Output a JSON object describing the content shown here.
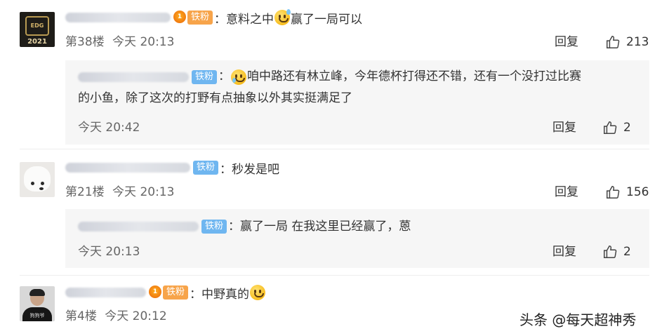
{
  "comments": [
    {
      "badge": "铁粉",
      "text": "：意料之中",
      "text_after_emoji": "赢了一局可以",
      "emoji": "sweat-smile",
      "avatar_year": "2021",
      "avatar_logo": "EDG",
      "floor": "第38楼",
      "time": "今天 20:13",
      "reply_label": "回复",
      "likes": "213",
      "reply": {
        "badge": "铁粉",
        "colon": "：",
        "emoji": "crying-sweat",
        "text_line1": "咱中路还有林立峰，今年德杯打得还不错，还有一个没打过比赛",
        "text_line2": "的小鱼，除了这次的打野有点抽象以外其实挺满足了",
        "time": "今天 20:42",
        "reply_label": "回复",
        "likes": "2"
      }
    },
    {
      "badge": "铁粉",
      "text": "：秒发是吧",
      "floor": "第21楼",
      "time": "今天 20:13",
      "reply_label": "回复",
      "likes": "156",
      "reply": {
        "badge": "铁粉",
        "text": "：赢了一局 在我这里已经赢了，蒽",
        "time": "今天 20:13",
        "reply_label": "回复",
        "likes": "2"
      }
    },
    {
      "badge": "铁粉",
      "text": "：中野真的",
      "emoji": "grin-sweat",
      "avatar_tag": "狗狗爷",
      "floor": "第4楼",
      "time": "今天 20:12"
    }
  ],
  "watermark": "头条 @每天超神秀",
  "colors": {
    "badge_blue": "#6fb6f0",
    "badge_orange": "#f7a44a",
    "reply_bg": "#f6f6f6",
    "meta_gray": "#666666"
  },
  "icons": {
    "like": "thumbs-up-icon",
    "crown": "fan-crown-icon"
  }
}
